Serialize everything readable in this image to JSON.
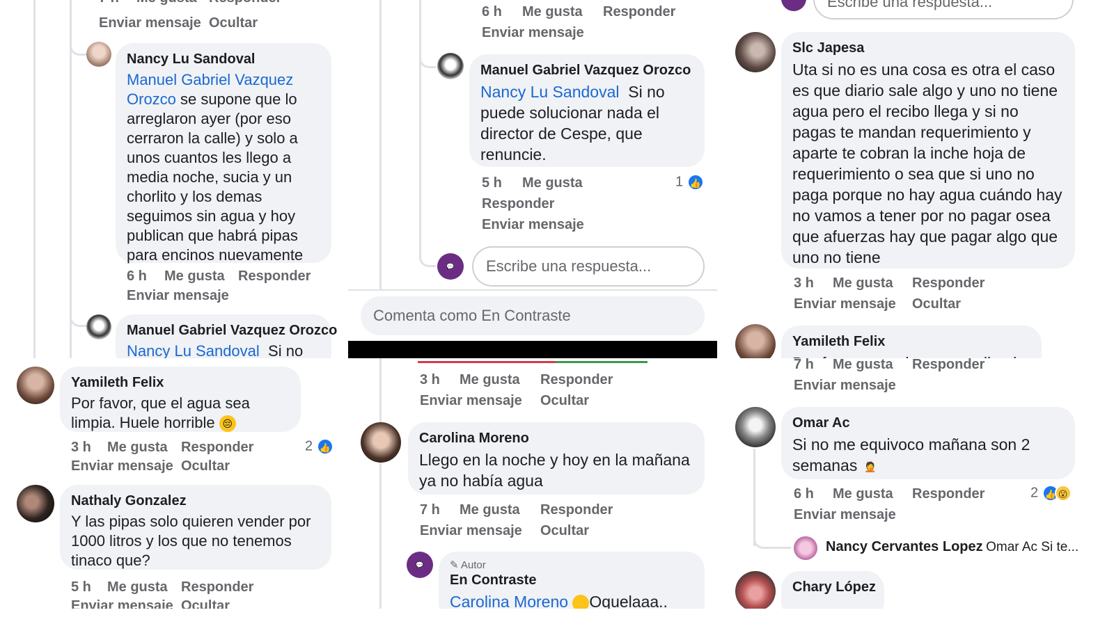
{
  "actions": {
    "like": "Me gusta",
    "reply": "Responder",
    "send": "Enviar mensaje",
    "hide": "Ocultar"
  },
  "p1": {
    "top_time": "7 h",
    "nancy": {
      "name": "Nancy Lu Sandoval",
      "mention": "Manuel Gabriel Vazquez Orozco",
      "text": "se supone que lo arreglaron ayer (por eso cerraron la calle) y solo a unos cuantos les llego a media noche, sucia y un chorlito y los demas seguimos sin agua y hoy publican que habrá  pipas para encinos nuevamente",
      "time": "6 h"
    },
    "manuel": {
      "name": "Manuel Gabriel Vazquez Orozco",
      "mention": "Nancy Lu Sandoval",
      "text": "Si no"
    }
  },
  "p2": {
    "time1": "6 h",
    "manuel": {
      "name": "Manuel Gabriel Vazquez Orozco",
      "mention": "Nancy Lu Sandoval",
      "text": "Si no puede solucionar nada  el director de Cespe,  que renuncie.",
      "time": "5 h",
      "reactions": "1"
    },
    "reply_placeholder": "Escribe una respuesta...",
    "comment_placeholder": "Comenta como En Contraste"
  },
  "p3": {
    "reply_placeholder": "Escribe una respuesta...",
    "slc": {
      "name": "Slc Japesa",
      "text": "Uta si no es una cosa es otra el caso es que diario sale algo y uno no tiene agua pero el recibo llega y si no pagas te mandan requerimiento y aparte te cobran la inche hoja de requerimiento o sea que si uno no paga porque no hay agua cuándo hay no vamos a tener por no pagar osea que  afuerzas hay que pagar algo que uno no tiene",
      "time": "3 h"
    },
    "yamileth": {
      "name": "Yamileth Felix",
      "text": "Por favor, que el agua sea limpia"
    }
  },
  "p4": {
    "yamileth": {
      "name": "Yamileth Felix",
      "text": "Por favor, que el agua sea limpia. Huele horrible",
      "emoji": "😔",
      "time": "3 h",
      "reactions": "2"
    },
    "nathaly": {
      "name": "Nathaly Gonzalez",
      "text": "Y las pipas solo quieren vender por 1000 litros y los que no tenemos tinaco que?",
      "time": "5 h"
    }
  },
  "p5": {
    "time1": "3 h",
    "carolina": {
      "name": "Carolina Moreno",
      "text": "Llego en la noche y hoy en la mañana ya no había agua",
      "time": "7 h"
    },
    "author_badge": "Autor",
    "en_contraste": {
      "name": "En Contraste",
      "mention": "Carolina Moreno",
      "text": "Oquelaaa.."
    }
  },
  "p6": {
    "time1": "7 h",
    "omar": {
      "name": "Omar Ac",
      "text": "Si  no me equivoco mañana son 2 semanas",
      "emoji": "🤦",
      "time": "6 h",
      "reactions": "2"
    },
    "nancy_cervantes": {
      "name": "Nancy Cervantes Lopez",
      "preview": "Omar Ac Si te..."
    },
    "chary": {
      "name": "Chary López"
    }
  }
}
